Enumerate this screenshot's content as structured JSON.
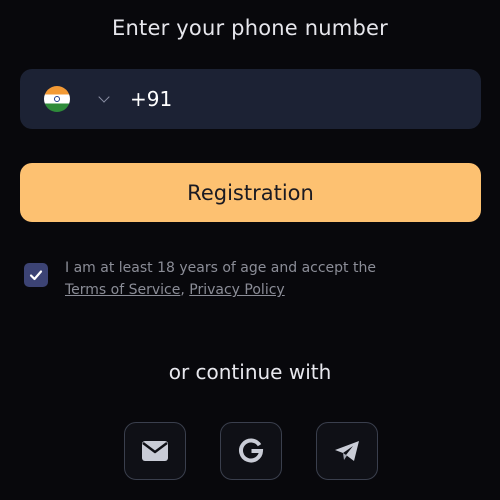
{
  "heading": "Enter your phone number",
  "phone": {
    "country": "India",
    "flag_icon": "india-flag-icon",
    "value": "+91"
  },
  "register_label": "Registration",
  "consent": {
    "checked": true,
    "text": "I am at least 18 years of age and accept the",
    "terms_link": "Terms of Service",
    "separator": ",",
    "privacy_link": "Privacy Policy"
  },
  "continue_with": "or continue with",
  "social": [
    {
      "name": "email",
      "icon": "envelope-icon"
    },
    {
      "name": "google",
      "icon": "google-icon"
    },
    {
      "name": "telegram",
      "icon": "telegram-icon"
    }
  ],
  "colors": {
    "background": "#08080c",
    "field": "#1c2234",
    "accent": "#fdc171",
    "checkbox": "#3c4374",
    "muted_text": "#8b8d97"
  }
}
